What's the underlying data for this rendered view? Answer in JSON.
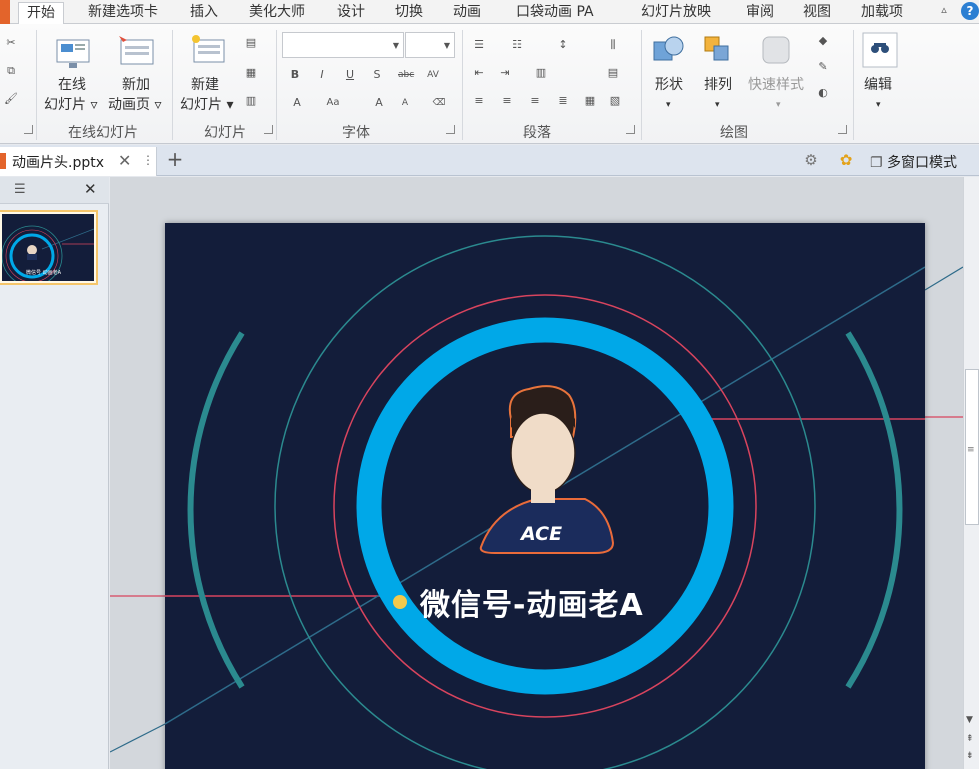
{
  "ribbon_tabs": {
    "home": "开始",
    "new_tab": "新建选项卡",
    "insert": "插入",
    "beautify": "美化大师",
    "design": "设计",
    "transitions": "切换",
    "animations": "动画",
    "pocket_anim": "口袋动画 PA",
    "slideshow": "幻灯片放映",
    "review": "审阅",
    "view": "视图",
    "addins": "加载项"
  },
  "ribbon": {
    "online_slides": {
      "btn1_line1": "在线",
      "btn1_line2": "幻灯片",
      "btn2_line1": "新加",
      "btn2_line2": "动画页",
      "group": "在线幻灯片"
    },
    "slides": {
      "new_line1": "新建",
      "new_line2": "幻灯片",
      "group": "幻灯片"
    },
    "font": {
      "group": "字体",
      "name_value": "",
      "size_value": ""
    },
    "paragraph": {
      "group": "段落"
    },
    "drawing": {
      "shape": "形状",
      "arrange": "排列",
      "quick_styles": "快速样式",
      "group": "绘图"
    },
    "editing": {
      "label": "编辑"
    }
  },
  "docbar": {
    "filename": "动画片头.pptx",
    "multi_window": "多窗口模式"
  },
  "slide": {
    "caption": "微信号-动画老A",
    "badge": "ACE"
  },
  "thumbnail": {
    "caption": "微信号 动画老A"
  },
  "colors": {
    "slide_bg": "#131d3a",
    "ring_blue": "#00a8e8",
    "ring_red": "#d8445e",
    "ring_teal": "#2b8a8f",
    "dot_yellow": "#f2c94c",
    "file_tab": "#e3642b"
  }
}
